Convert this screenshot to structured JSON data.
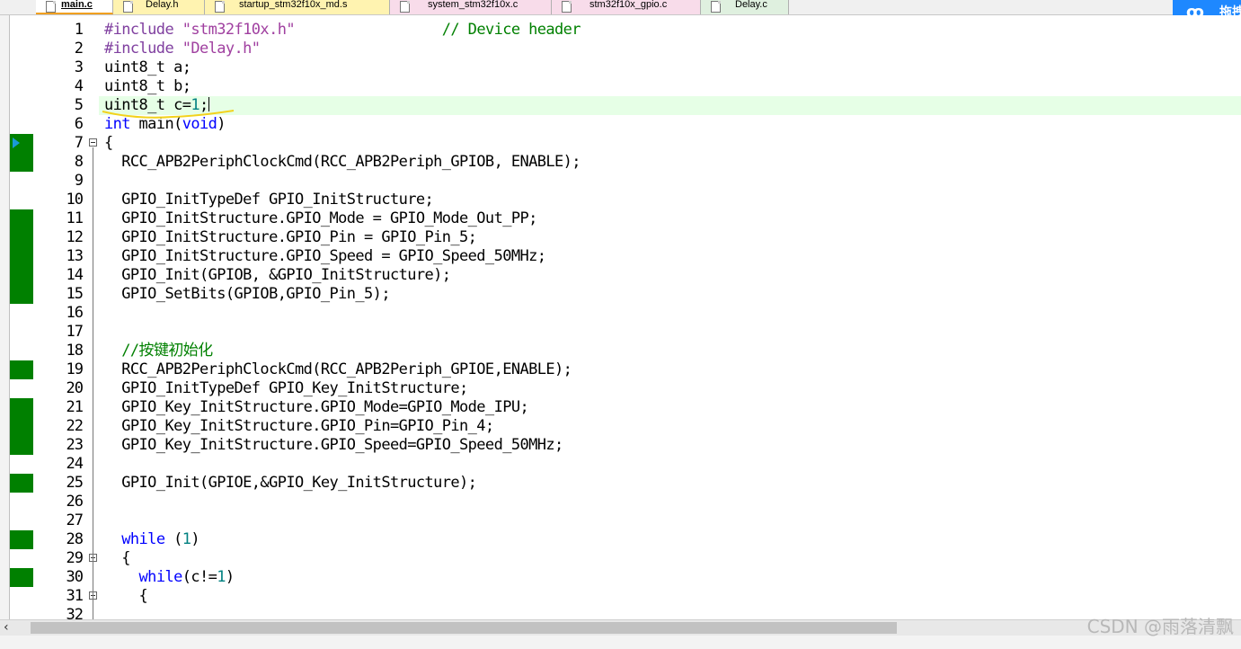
{
  "tabs": [
    {
      "label": "main.c",
      "active": true
    },
    {
      "label": "Delay.h",
      "active": false
    },
    {
      "label": "startup_stm32f10x_md.s",
      "active": false
    },
    {
      "label": "system_stm32f10x.c",
      "active": false
    },
    {
      "label": "stm32f10x_gpio.c",
      "active": false
    },
    {
      "label": "Delay.c",
      "active": false
    }
  ],
  "colors": {
    "coverage_executed": "#008000",
    "current_line_bg": "#e6ffe6",
    "keyword": "#0000ff",
    "preprocessor": "#8040a0",
    "comment": "#008000",
    "number": "#008080",
    "tab_yellow": "#fff3b0",
    "tab_pink": "#f8dcea",
    "tab_green": "#dff0df"
  },
  "side_widget": {
    "icon": "baidu-netdisk-icon",
    "label": "拖拽"
  },
  "watermark": "CSDN @雨落清飘",
  "lines": [
    {
      "n": "1",
      "parts": [
        [
          "#include ",
          "pp"
        ],
        [
          "\"stm32f10x.h\"",
          "str"
        ],
        [
          "                 ",
          ""
        ],
        [
          "// Device header",
          "cm"
        ]
      ]
    },
    {
      "n": "2",
      "parts": [
        [
          "#include ",
          "pp"
        ],
        [
          "\"Delay.h\"",
          "str"
        ]
      ]
    },
    {
      "n": "3",
      "parts": [
        [
          "uint8_t a;",
          ""
        ]
      ]
    },
    {
      "n": "4",
      "parts": [
        [
          "uint8_t b;",
          ""
        ]
      ]
    },
    {
      "n": "5",
      "current": true,
      "caret": true,
      "parts": [
        [
          "uint8_t c=",
          ""
        ],
        [
          "1",
          "num"
        ],
        [
          ";",
          ""
        ]
      ]
    },
    {
      "n": "6",
      "parts": [
        [
          "int",
          "kw"
        ],
        [
          " main(",
          ""
        ],
        [
          "void",
          "kw"
        ],
        [
          ")",
          ""
        ]
      ]
    },
    {
      "n": "7",
      "exec": true,
      "arrow": true,
      "fold": true,
      "parts": [
        [
          "{",
          ""
        ]
      ]
    },
    {
      "n": "8",
      "exec": true,
      "parts": [
        [
          "  RCC_APB2PeriphClockCmd(RCC_APB2Periph_GPIOB, ENABLE);",
          ""
        ]
      ]
    },
    {
      "n": "9",
      "parts": []
    },
    {
      "n": "10",
      "parts": [
        [
          "  GPIO_InitTypeDef GPIO_InitStructure;",
          ""
        ]
      ]
    },
    {
      "n": "11",
      "exec": true,
      "parts": [
        [
          "  GPIO_InitStructure.GPIO_Mode = GPIO_Mode_Out_PP;",
          ""
        ]
      ]
    },
    {
      "n": "12",
      "exec": true,
      "parts": [
        [
          "  GPIO_InitStructure.GPIO_Pin = GPIO_Pin_5;",
          ""
        ]
      ]
    },
    {
      "n": "13",
      "exec": true,
      "parts": [
        [
          "  GPIO_InitStructure.GPIO_Speed = GPIO_Speed_50MHz;",
          ""
        ]
      ]
    },
    {
      "n": "14",
      "exec": true,
      "parts": [
        [
          "  GPIO_Init(GPIOB, &GPIO_InitStructure);",
          ""
        ]
      ]
    },
    {
      "n": "15",
      "exec": true,
      "parts": [
        [
          "  GPIO_SetBits(GPIOB,GPIO_Pin_5);",
          ""
        ]
      ]
    },
    {
      "n": "16",
      "parts": []
    },
    {
      "n": "17",
      "parts": []
    },
    {
      "n": "18",
      "parts": [
        [
          "  //按键初始化",
          "cm"
        ]
      ]
    },
    {
      "n": "19",
      "exec": true,
      "parts": [
        [
          "  RCC_APB2PeriphClockCmd(RCC_APB2Periph_GPIOE,ENABLE);",
          ""
        ]
      ]
    },
    {
      "n": "20",
      "parts": [
        [
          "  GPIO_InitTypeDef GPIO_Key_InitStructure;",
          ""
        ]
      ]
    },
    {
      "n": "21",
      "exec": true,
      "parts": [
        [
          "  GPIO_Key_InitStructure.GPIO_Mode=GPIO_Mode_IPU;",
          ""
        ]
      ]
    },
    {
      "n": "22",
      "exec": true,
      "parts": [
        [
          "  GPIO_Key_InitStructure.GPIO_Pin=GPIO_Pin_4;",
          ""
        ]
      ]
    },
    {
      "n": "23",
      "exec": true,
      "parts": [
        [
          "  GPIO_Key_InitStructure.GPIO_Speed=GPIO_Speed_50MHz;",
          ""
        ]
      ]
    },
    {
      "n": "24",
      "parts": []
    },
    {
      "n": "25",
      "exec": true,
      "parts": [
        [
          "  GPIO_Init(GPIOE,&GPIO_Key_InitStructure);",
          ""
        ]
      ]
    },
    {
      "n": "26",
      "parts": []
    },
    {
      "n": "27",
      "parts": []
    },
    {
      "n": "28",
      "exec": true,
      "parts": [
        [
          "  ",
          ""
        ],
        [
          "while",
          "kw"
        ],
        [
          " (",
          ""
        ],
        [
          "1",
          "num"
        ],
        [
          ")",
          ""
        ]
      ]
    },
    {
      "n": "29",
      "fold": true,
      "parts": [
        [
          "  {",
          ""
        ]
      ]
    },
    {
      "n": "30",
      "exec": true,
      "parts": [
        [
          "    ",
          ""
        ],
        [
          "while",
          "kw"
        ],
        [
          "(c!=",
          ""
        ],
        [
          "1",
          "num"
        ],
        [
          ")",
          ""
        ]
      ]
    },
    {
      "n": "31",
      "fold": true,
      "parts": [
        [
          "    {",
          ""
        ]
      ]
    },
    {
      "n": "32",
      "parts": []
    }
  ]
}
